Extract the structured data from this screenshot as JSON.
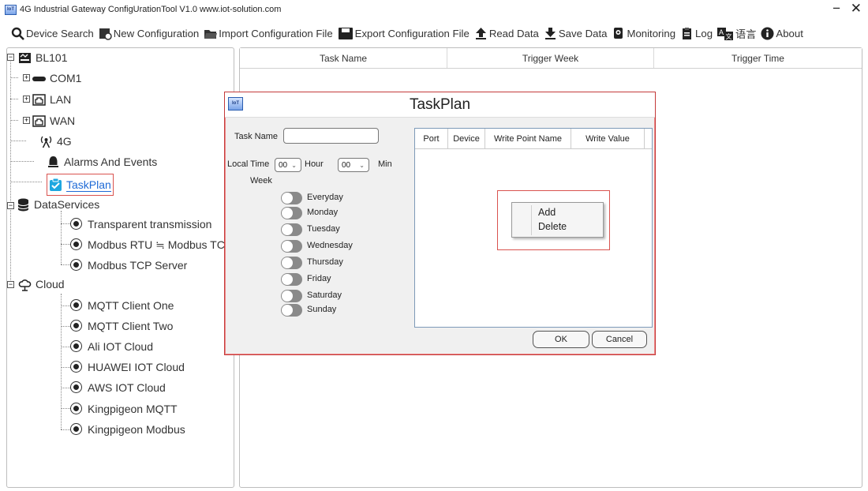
{
  "window": {
    "title": "4G Industrial Gateway ConfigUrationTool V1.0 www.iot-solution.com",
    "controls": "− ✕",
    "icon_text": "IoT"
  },
  "toolbar": {
    "device_search": "Device Search",
    "new_configuration": "New Configuration",
    "import_configuration": "Import Configuration File",
    "export_configuration": "Export Configuration File",
    "read_data": "Read Data",
    "save_data": "Save Data",
    "monitoring": "Monitoring",
    "log": "Log",
    "language": "语言",
    "about": "About"
  },
  "tree": {
    "root": "BL101",
    "com1": "COM1",
    "lan": "LAN",
    "wan": "WAN",
    "g4": "4G",
    "alarms": "Alarms And Events",
    "taskplan": "TaskPlan",
    "dataservices": "DataServices",
    "transparent": "Transparent transmission",
    "modbus_rtu_tcp": "Modbus RTU ≒ Modbus TCP",
    "modbus_tcp_server": "Modbus TCP Server",
    "cloud": "Cloud",
    "mqtt_one": "MQTT Client One",
    "mqtt_two": "MQTT Client Two",
    "ali": "Ali IOT Cloud",
    "huawei": "HUAWEI IOT Cloud",
    "aws": "AWS IOT Cloud",
    "kp_mqtt": "Kingpigeon MQTT",
    "kp_modbus": "Kingpigeon Modbus"
  },
  "table": {
    "columns": [
      "Task Name",
      "Trigger Week",
      "Trigger Time"
    ]
  },
  "dialog": {
    "title": "TaskPlan",
    "task_name_label": "Task Name",
    "task_name_value": "",
    "local_time_label": "Local Time",
    "hour_value": "00",
    "hour_label": "Hour",
    "min_value": "00",
    "min_label": "Min",
    "week_label": "Week",
    "days": [
      "Everyday",
      "Monday",
      "Tuesday",
      "Wednesday",
      "Thursday",
      "Friday",
      "Saturday",
      "Sunday"
    ],
    "columns": [
      "Port",
      "Device",
      "Write Point Name",
      "Write Value"
    ],
    "ok": "OK",
    "cancel": "Cancel"
  },
  "context_menu": {
    "add": "Add",
    "delete": "Delete"
  },
  "colors": {
    "highlight_border": "#d9534f",
    "selected_text": "#1e6ad6",
    "toggle_off": "#8a8a8a"
  }
}
